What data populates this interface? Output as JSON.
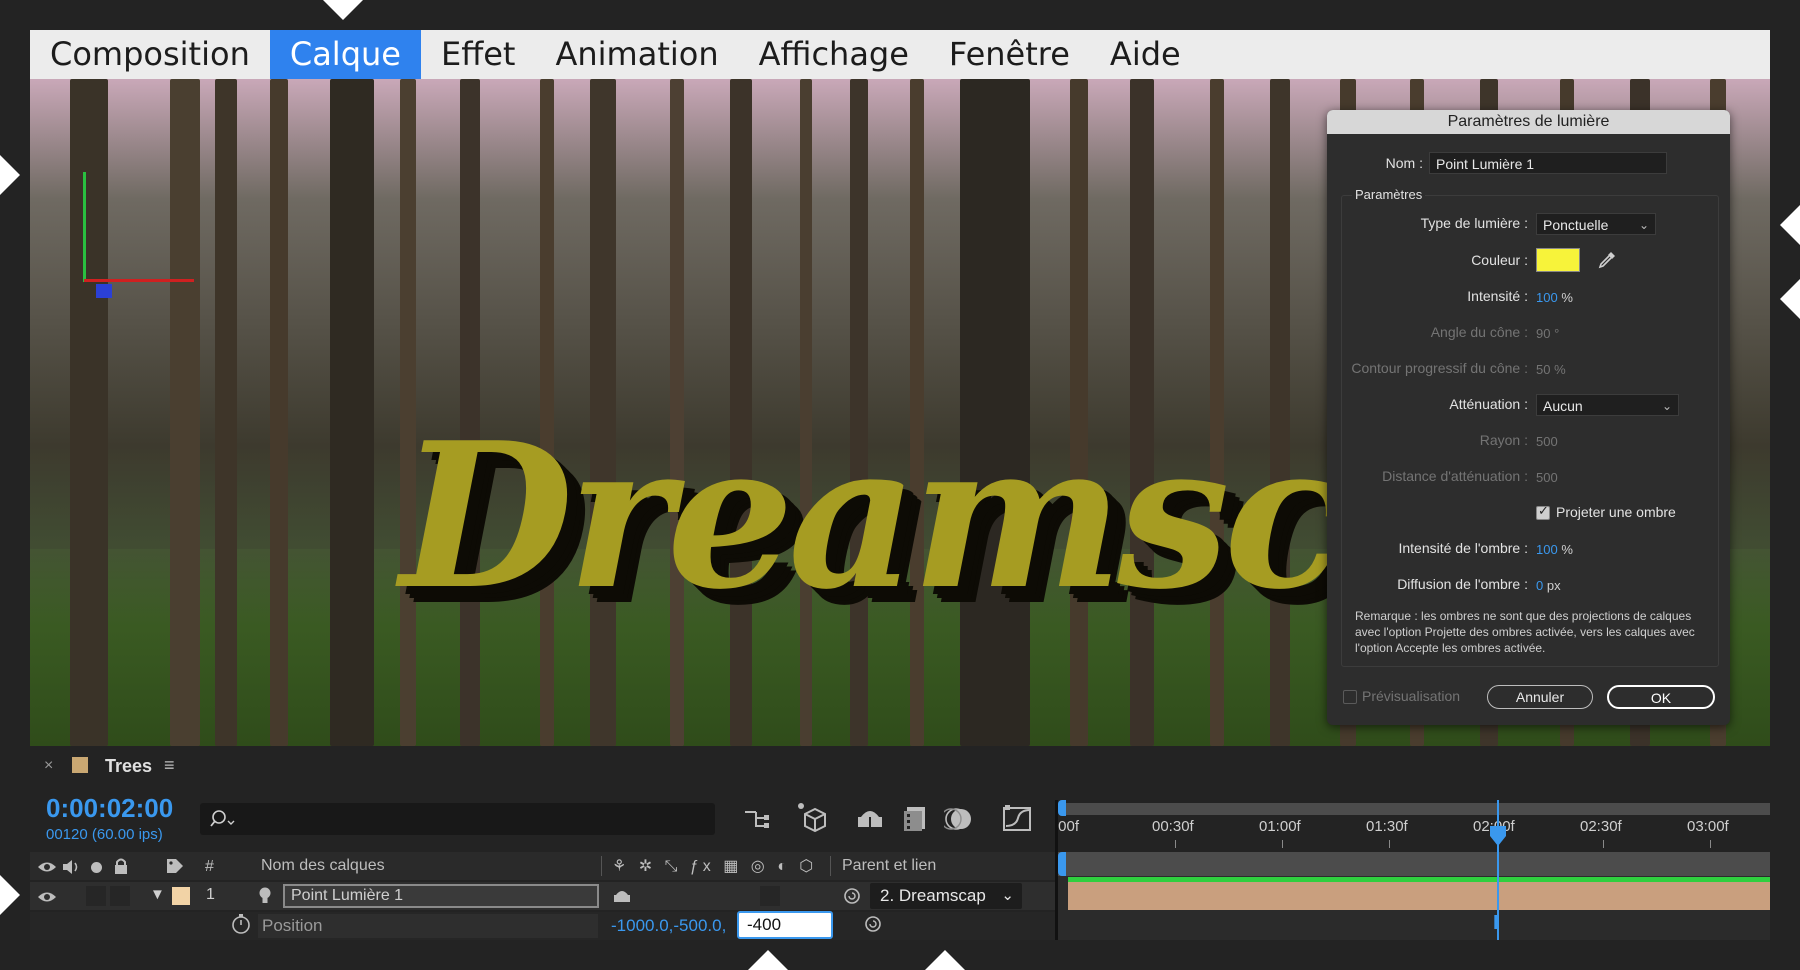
{
  "menubar": {
    "items": [
      "Composition",
      "Calque",
      "Effet",
      "Animation",
      "Affichage",
      "Fenêtre",
      "Aide"
    ],
    "active": "Calque"
  },
  "viewer": {
    "text": "Dreamscap"
  },
  "dialog": {
    "title": "Paramètres de lumière",
    "name_label": "Nom :",
    "name_value": "Point Lumière 1",
    "section_label": "Paramètres",
    "light_type_label": "Type de lumière :",
    "light_type_value": "Ponctuelle",
    "color_label": "Couleur :",
    "color_value": "#f7f33a",
    "intensity_label": "Intensité :",
    "intensity_value": "100",
    "intensity_unit": "%",
    "cone_angle_label": "Angle du cône :",
    "cone_angle_value": "90 °",
    "cone_feather_label": "Contour progressif du cône :",
    "cone_feather_value": "50 %",
    "falloff_label": "Atténuation :",
    "falloff_value": "Aucun",
    "radius_label": "Rayon :",
    "radius_value": "500",
    "falloff_distance_label": "Distance d'atténuation :",
    "falloff_distance_value": "500",
    "cast_shadows_label": "Projeter une ombre",
    "cast_shadows_checked": true,
    "shadow_darkness_label": "Intensité de l'ombre :",
    "shadow_darkness_value": "100",
    "shadow_darkness_unit": "%",
    "shadow_diffusion_label": "Diffusion de l'ombre :",
    "shadow_diffusion_value": "0",
    "shadow_diffusion_unit": "px",
    "remark": "Remarque : les ombres ne sont que des projections de calques avec l'option Projette des ombres activée, vers les calques avec l'option Accepte les ombres activée.",
    "preview_label": "Prévisualisation",
    "preview_checked": false,
    "cancel_label": "Annuler",
    "ok_label": "OK"
  },
  "timeline": {
    "comp_name": "Trees",
    "close_glyph": "×",
    "menu_glyph": "≡",
    "timecode": "0:00:02:00",
    "frames": "00120 (60.00 ips)",
    "ruler_labels": [
      ":00f",
      "00:30f",
      "01:00f",
      "01:30f",
      "02:00f",
      "02:30f",
      "03:00f"
    ],
    "col_hash": "#",
    "col_layer_name": "Nom des calques",
    "col_parent": "Parent et lien",
    "layer_number": "1",
    "layer_name": "Point Lumière 1",
    "layer_parent": "2. Dreamscap",
    "property_name": "Position",
    "property_value": "-1000.0,-500.0,",
    "property_edit_value": "-400",
    "accent_color": "#3a98ee",
    "label_color": "#f2d3a6"
  }
}
